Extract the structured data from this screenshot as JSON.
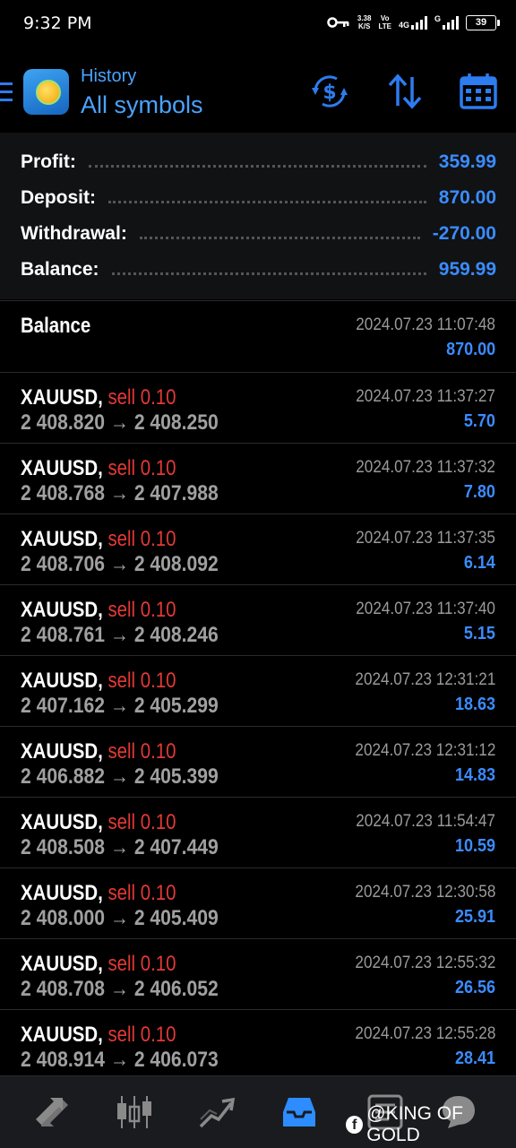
{
  "status_bar": {
    "time": "9:32 PM",
    "net_speed_value": "3.38",
    "net_speed_unit": "K/S",
    "volte_top": "Vo",
    "volte_bottom": "LTE",
    "network_4g": "4G",
    "network_g": "G",
    "battery": "39"
  },
  "header": {
    "subtitle": "History",
    "title": "All symbols",
    "icons": [
      "dollar-refresh-icon",
      "sort-icon",
      "calendar-icon"
    ],
    "accent_color": "#4aa3ff"
  },
  "summary": [
    {
      "label": "Profit:",
      "value": "359.99"
    },
    {
      "label": "Deposit:",
      "value": "870.00"
    },
    {
      "label": "Withdrawal:",
      "value": "-270.00"
    },
    {
      "label": "Balance:",
      "value": "959.99"
    }
  ],
  "balance_entry": {
    "label": "Balance",
    "datetime": "2024.07.23 11:07:48",
    "amount": "870.00"
  },
  "trades": [
    {
      "symbol": "XAUUSD,",
      "side": "sell 0.10",
      "prices": "2 408.820 → 2 408.250",
      "datetime": "2024.07.23 11:37:27",
      "profit": "5.70"
    },
    {
      "symbol": "XAUUSD,",
      "side": "sell 0.10",
      "prices": "2 408.768 → 2 407.988",
      "datetime": "2024.07.23 11:37:32",
      "profit": "7.80"
    },
    {
      "symbol": "XAUUSD,",
      "side": "sell 0.10",
      "prices": "2 408.706 → 2 408.092",
      "datetime": "2024.07.23 11:37:35",
      "profit": "6.14"
    },
    {
      "symbol": "XAUUSD,",
      "side": "sell 0.10",
      "prices": "2 408.761 → 2 408.246",
      "datetime": "2024.07.23 11:37:40",
      "profit": "5.15"
    },
    {
      "symbol": "XAUUSD,",
      "side": "sell 0.10",
      "prices": "2 407.162 → 2 405.299",
      "datetime": "2024.07.23 12:31:21",
      "profit": "18.63"
    },
    {
      "symbol": "XAUUSD,",
      "side": "sell 0.10",
      "prices": "2 406.882 → 2 405.399",
      "datetime": "2024.07.23 12:31:12",
      "profit": "14.83"
    },
    {
      "symbol": "XAUUSD,",
      "side": "sell 0.10",
      "prices": "2 408.508 → 2 407.449",
      "datetime": "2024.07.23 11:54:47",
      "profit": "10.59"
    },
    {
      "symbol": "XAUUSD,",
      "side": "sell 0.10",
      "prices": "2 408.000 → 2 405.409",
      "datetime": "2024.07.23 12:30:58",
      "profit": "25.91"
    },
    {
      "symbol": "XAUUSD,",
      "side": "sell 0.10",
      "prices": "2 408.708 → 2 406.052",
      "datetime": "2024.07.23 12:55:32",
      "profit": "26.56"
    },
    {
      "symbol": "XAUUSD,",
      "side": "sell 0.10",
      "prices": "2 408.914 → 2 406.073",
      "datetime": "2024.07.23 12:55:28",
      "profit": "28.41"
    }
  ],
  "bottom_nav": {
    "items": [
      "quotes-icon",
      "chart-icon",
      "trade-icon",
      "history-icon",
      "news-icon",
      "chat-icon"
    ],
    "active": "history-icon",
    "watermark": "@KING OF GOLD"
  }
}
